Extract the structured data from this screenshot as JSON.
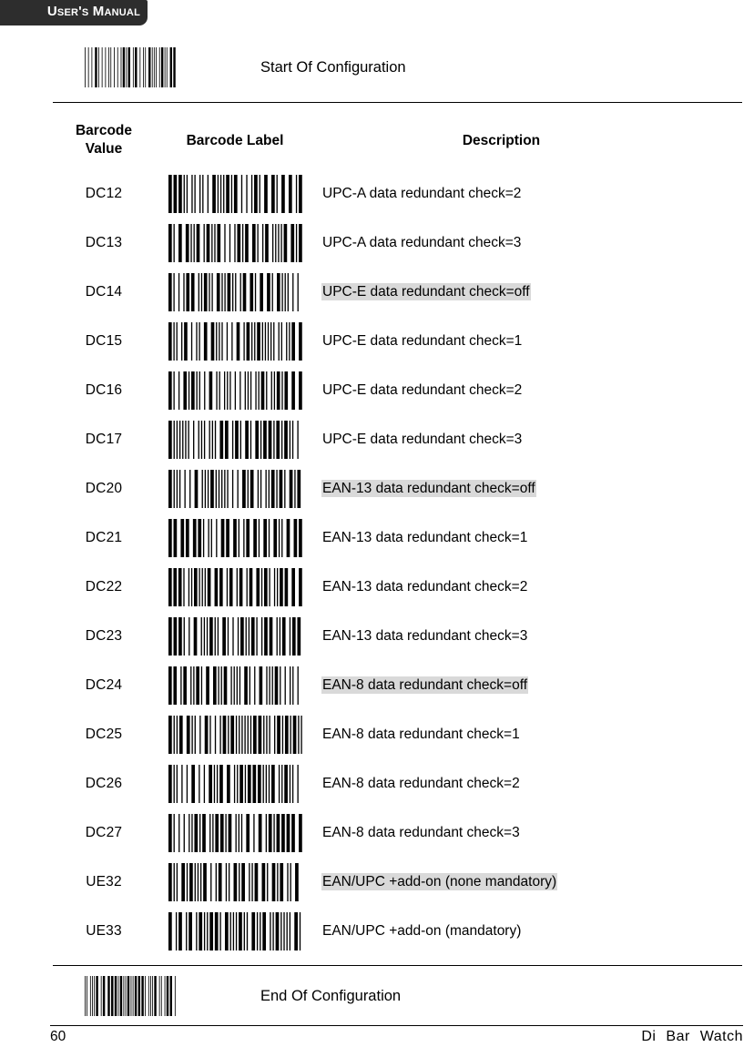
{
  "header": {
    "title": "User's Manual",
    "bar_color": "#2d2d2d"
  },
  "config_start": {
    "label": "Start Of Configuration",
    "barcode_icon": "barcode-code39"
  },
  "config_end": {
    "label": "End Of Configuration",
    "barcode_icon": "barcode-code39"
  },
  "table": {
    "headers": {
      "value_line1": "Barcode",
      "value_line2": "Value",
      "label": "Barcode Label",
      "description": "Description"
    },
    "highlight_color": "#d9d9d9",
    "rows": [
      {
        "value": "DC12",
        "description": "UPC-A data redundant check=2",
        "highlighted": false,
        "barcode_icon": "barcode-code39"
      },
      {
        "value": "DC13",
        "description": "UPC-A data redundant check=3",
        "highlighted": false,
        "barcode_icon": "barcode-code39"
      },
      {
        "value": "DC14",
        "description": "UPC-E data redundant check=off",
        "highlighted": true,
        "barcode_icon": "barcode-code39"
      },
      {
        "value": "DC15",
        "description": "UPC-E data redundant check=1",
        "highlighted": false,
        "barcode_icon": "barcode-code39"
      },
      {
        "value": "DC16",
        "description": "UPC-E data redundant check=2",
        "highlighted": false,
        "barcode_icon": "barcode-code39"
      },
      {
        "value": "DC17",
        "description": "UPC-E data redundant check=3",
        "highlighted": false,
        "barcode_icon": "barcode-code39"
      },
      {
        "value": "DC20",
        "description": "EAN-13 data redundant check=off",
        "highlighted": true,
        "barcode_icon": "barcode-code39"
      },
      {
        "value": "DC21",
        "description": "EAN-13 data redundant check=1",
        "highlighted": false,
        "barcode_icon": "barcode-code39"
      },
      {
        "value": "DC22",
        "description": "EAN-13 data redundant check=2",
        "highlighted": false,
        "barcode_icon": "barcode-code39"
      },
      {
        "value": "DC23",
        "description": "EAN-13 data redundant check=3",
        "highlighted": false,
        "barcode_icon": "barcode-code39"
      },
      {
        "value": "DC24",
        "description": "EAN-8 data redundant check=off",
        "highlighted": true,
        "barcode_icon": "barcode-code39"
      },
      {
        "value": "DC25",
        "description": "EAN-8 data redundant check=1",
        "highlighted": false,
        "barcode_icon": "barcode-code39"
      },
      {
        "value": "DC26",
        "description": "EAN-8 data redundant check=2",
        "highlighted": false,
        "barcode_icon": "barcode-code39"
      },
      {
        "value": "DC27",
        "description": "EAN-8 data redundant check=3",
        "highlighted": false,
        "barcode_icon": "barcode-code39"
      },
      {
        "value": "UE32",
        "description": "EAN/UPC +add-on (none mandatory)",
        "highlighted": true,
        "barcode_icon": "barcode-code39"
      },
      {
        "value": "UE33",
        "description": "EAN/UPC +add-on (mandatory)",
        "highlighted": false,
        "barcode_icon": "barcode-code39"
      }
    ]
  },
  "footer": {
    "page_number": "60",
    "brand": "Di Bar Watch"
  }
}
